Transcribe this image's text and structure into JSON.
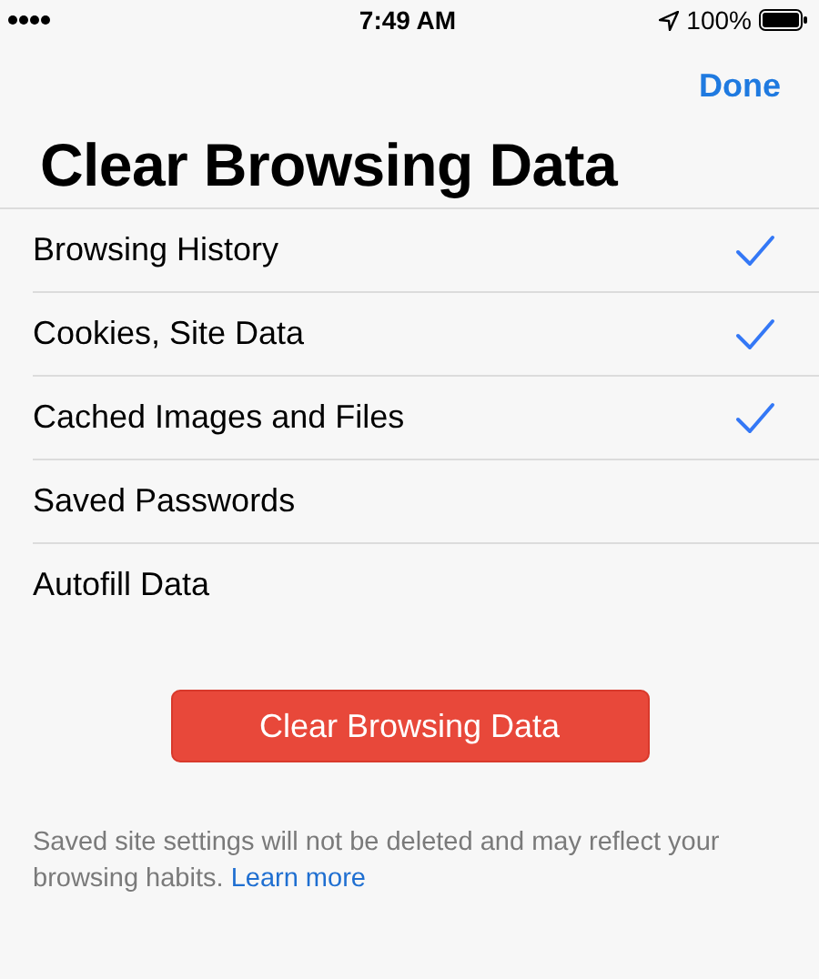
{
  "status_bar": {
    "time": "7:49 AM",
    "battery": "100%"
  },
  "nav": {
    "done": "Done"
  },
  "title": "Clear Browsing Data",
  "items": [
    {
      "label": "Browsing History",
      "checked": true
    },
    {
      "label": "Cookies, Site Data",
      "checked": true
    },
    {
      "label": "Cached Images and Files",
      "checked": true
    },
    {
      "label": "Saved Passwords",
      "checked": false
    },
    {
      "label": "Autofill Data",
      "checked": false
    }
  ],
  "action_button": "Clear Browsing Data",
  "footer": {
    "text": "Saved site settings will not be deleted and may reflect your browsing habits.",
    "link": "Learn more"
  }
}
